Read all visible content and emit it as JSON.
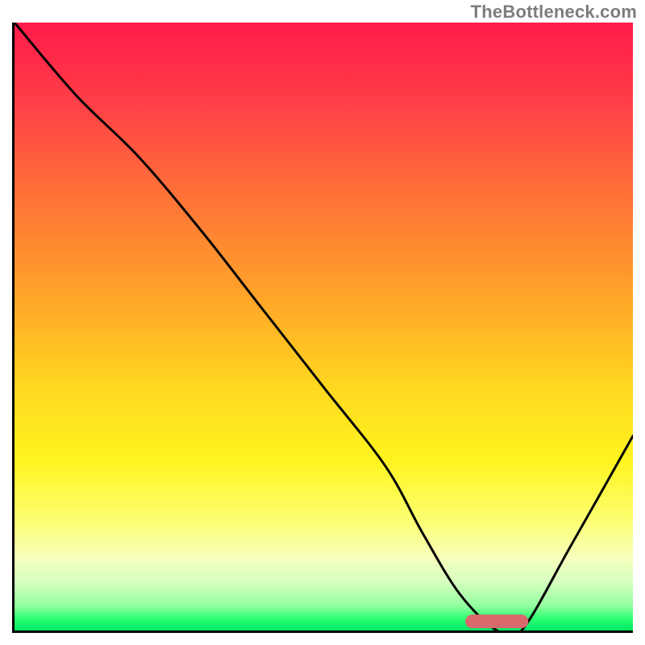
{
  "watermark": "TheBottleneck.com",
  "chart_data": {
    "type": "line",
    "title": "",
    "xlabel": "",
    "ylabel": "",
    "xlim": [
      0,
      100
    ],
    "ylim": [
      0,
      100
    ],
    "grid": false,
    "legend": false,
    "series": [
      {
        "name": "bottleneck-curve",
        "x": [
          0,
          10,
          20,
          30,
          40,
          50,
          60,
          66,
          72,
          78,
          82,
          90,
          100
        ],
        "y": [
          100,
          88,
          78,
          66,
          53,
          40,
          27,
          16,
          6,
          0,
          0,
          14,
          32
        ]
      }
    ],
    "annotations": [
      {
        "name": "optimal-marker",
        "type": "segment",
        "x0": 74,
        "y0": 1.5,
        "x1": 82,
        "y1": 1.5,
        "color": "#d86a6e"
      }
    ]
  }
}
